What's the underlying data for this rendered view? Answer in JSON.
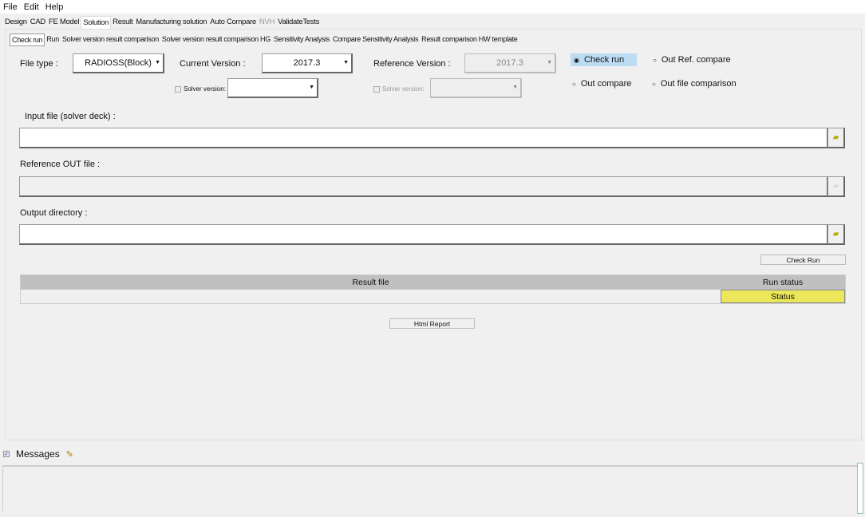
{
  "menu": [
    "File",
    "Edit",
    "Help"
  ],
  "main_tabs": [
    {
      "label": "Design"
    },
    {
      "label": "CAD"
    },
    {
      "label": "FE Model"
    },
    {
      "label": "Solution",
      "active": true
    },
    {
      "label": "Result"
    },
    {
      "label": "Manufacturing solution"
    },
    {
      "label": "Auto Compare"
    },
    {
      "label": "NVH",
      "disabled": true
    },
    {
      "label": "ValidateTests"
    }
  ],
  "sub_tabs": [
    {
      "label": "Check run",
      "active": true
    },
    {
      "label": "Run"
    },
    {
      "label": "Solver version result comparison"
    },
    {
      "label": "Solver version result comparison HG"
    },
    {
      "label": "Sensitivity Analysis"
    },
    {
      "label": "Compare Sensitivity Analysis"
    },
    {
      "label": "Result comparison HW template"
    }
  ],
  "form": {
    "file_type_label": "File type :",
    "file_type_value": "RADIOSS(Block)",
    "current_version_label": "Current Version :",
    "current_version_value": "2017.3",
    "reference_version_label": "Reference Version :",
    "reference_version_value": "2017.3",
    "solver_version_label": "Solver version:",
    "solver_version_value": "",
    "ref_solver_version_label": "Solver version:",
    "radios": [
      {
        "label": "Check run",
        "selected": true
      },
      {
        "label": "Out Ref. compare"
      },
      {
        "label": "Out compare"
      },
      {
        "label": "Out file comparison"
      }
    ],
    "input_file_label": "Input file (solver deck) :",
    "input_file_value": "",
    "reference_out_label": "Reference OUT file :",
    "reference_out_value": "",
    "output_dir_label": "Output directory :",
    "output_dir_value": "",
    "check_run_button": "Check Run",
    "html_report_button": "Html Report"
  },
  "table": {
    "headers": [
      "Result file",
      "Run status"
    ],
    "rows": [
      {
        "file": "",
        "status": "Status"
      }
    ],
    "status_color": "#ece75a"
  },
  "messages": {
    "label": "Messages",
    "checked": true
  }
}
